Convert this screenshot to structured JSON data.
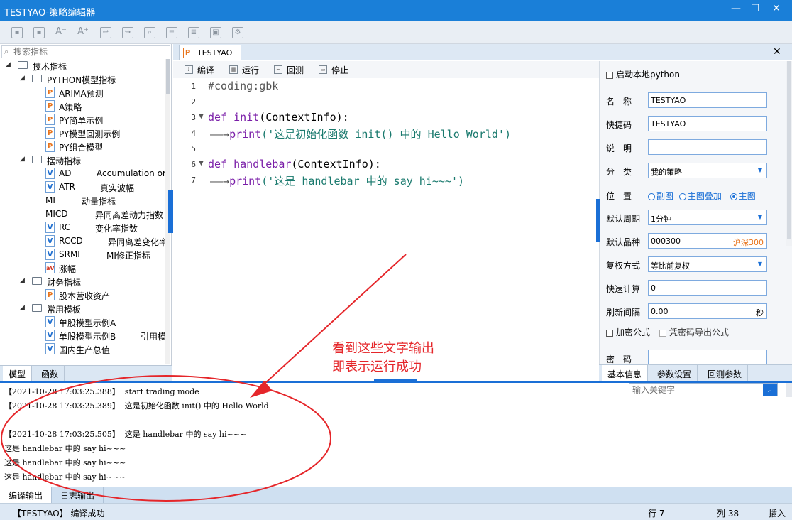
{
  "window": {
    "title": "TESTYAO-策略编辑器",
    "minimize_glyph": "—",
    "maximize_glyph": "☐",
    "close_glyph": "✕"
  },
  "toolbar": {
    "icons": [
      "save-icon",
      "save-as-icon",
      "font-decrease-icon",
      "font-increase-icon",
      "import-icon",
      "export-icon",
      "find-icon",
      "doc-icon",
      "doc-list-icon",
      "image-icon",
      "settings-icon"
    ]
  },
  "left": {
    "search_placeholder": "搜索指标",
    "tree": [
      {
        "level": 0,
        "type": "folder",
        "label": "技术指标"
      },
      {
        "level": 1,
        "type": "folder",
        "label": "PYTHON模型指标"
      },
      {
        "level": 2,
        "type": "p",
        "label": "ARIMA预测"
      },
      {
        "level": 2,
        "type": "p",
        "label": "A策略"
      },
      {
        "level": 2,
        "type": "p",
        "label": "PY简单示例"
      },
      {
        "level": 2,
        "type": "p",
        "label": "PY模型回测示例"
      },
      {
        "level": 2,
        "type": "p",
        "label": "PY组合模型"
      },
      {
        "level": 1,
        "type": "folder",
        "label": "摆动指标"
      },
      {
        "level": 2,
        "type": "v",
        "label": "AD",
        "desc": "Accumulation or"
      },
      {
        "level": 2,
        "type": "v",
        "label": "ATR",
        "desc": "真实波幅"
      },
      {
        "level": 2,
        "type": "none",
        "label": "MI",
        "desc": "动量指标"
      },
      {
        "level": 2,
        "type": "none",
        "label": "MICD",
        "desc": "异同离差动力指数"
      },
      {
        "level": 2,
        "type": "v",
        "label": "RC",
        "desc": "变化率指数"
      },
      {
        "level": 2,
        "type": "v",
        "label": "RCCD",
        "desc": "异同离差变化率"
      },
      {
        "level": 2,
        "type": "v",
        "label": "SRMI",
        "desc": "MI修正指标"
      },
      {
        "level": 2,
        "type": "av",
        "label": "涨幅"
      },
      {
        "level": 1,
        "type": "folder",
        "label": "财务指标"
      },
      {
        "level": 2,
        "type": "p",
        "label": "股本营收资产"
      },
      {
        "level": 1,
        "type": "folder",
        "label": "常用模板"
      },
      {
        "level": 2,
        "type": "v",
        "label": "单股模型示例A"
      },
      {
        "level": 2,
        "type": "v",
        "label": "单股模型示例B",
        "desc": "引用模"
      },
      {
        "level": 2,
        "type": "v",
        "label": "国内生产总值"
      }
    ],
    "tabs": [
      "模型",
      "函数"
    ]
  },
  "editor": {
    "tab_label": "TESTYAO",
    "tab_icon": "P",
    "toolbar": [
      {
        "icon": "compile-icon",
        "label": "编译"
      },
      {
        "icon": "run-icon",
        "label": "运行"
      },
      {
        "icon": "backtest-icon",
        "label": "回测"
      },
      {
        "icon": "stop-icon",
        "label": "停止"
      }
    ],
    "lines": [
      {
        "n": "1",
        "text": "#coding:gbk"
      },
      {
        "n": "2",
        "text": ""
      },
      {
        "n": "3",
        "text": "def init(ContextInfo):"
      },
      {
        "n": "4",
        "text": "    print('这是初始化函数 init() 中的 Hello World')"
      },
      {
        "n": "5",
        "text": ""
      },
      {
        "n": "6",
        "text": "def handlebar(ContextInfo):"
      },
      {
        "n": "7",
        "text": "    print('这是 handlebar 中的 say hi~~~')"
      }
    ],
    "tokens": {
      "l1": "#coding:gbk",
      "def": "def",
      "init_name": "init",
      "init_params": "(ContextInfo):",
      "print": "print",
      "l4_str": "('这是初始化函数 init() 中的 Hello World')",
      "hb_name": "handlebar",
      "hb_params": "(ContextInfo):",
      "l7_str": "('这是 handlebar 中的 say hi~~~')",
      "tab_arrow": "——→"
    }
  },
  "props": {
    "start_local_python": "启动本地python",
    "name_label": "名　称",
    "name_value": "TESTYAO",
    "shortcut_label": "快捷码",
    "shortcut_value": "TESTYAO",
    "desc_label": "说　明",
    "desc_value": "",
    "category_label": "分　类",
    "category_value": "我的策略",
    "position_label": "位　置",
    "position_options": [
      "副图",
      "主图叠加",
      "主图"
    ],
    "position_selected": "主图",
    "period_label": "默认周期",
    "period_value": "1分钟",
    "symbol_label": "默认品种",
    "symbol_value": "000300",
    "symbol_name": "沪深300",
    "adjust_label": "复权方式",
    "adjust_value": "等比前复权",
    "quick_calc_label": "快速计算",
    "quick_calc_value": "0",
    "refresh_label": "刷新间隔",
    "refresh_value": "0.00",
    "refresh_unit": "秒",
    "encrypt_label": "加密公式",
    "pwd_export_label": "凭密码导出公式",
    "password_label": "密　码",
    "tabs": [
      "基本信息",
      "参数设置",
      "回测参数"
    ]
  },
  "output": {
    "search_placeholder": "输入关键字",
    "lines": [
      "【2021-10-28 17:03:25.388】  start trading mode",
      "【2021-10-28 17:03:25.389】  这是初始化函数 init() 中的 Hello World",
      "",
      "【2021-10-28 17:03:25.505】  这是 handlebar 中的 say hi~~~",
      "这是 handlebar 中的 say hi~~~",
      "这是 handlebar 中的 say hi~~~",
      "这是 handlebar 中的 say hi~~~"
    ],
    "tabs": [
      "编译输出",
      "日志输出"
    ]
  },
  "status": {
    "message": "【TESTYAO】 编译成功",
    "row_label": "行 7",
    "col_label": "列 38",
    "mode": "插入"
  },
  "annotation": {
    "line1": "看到这些文字输出",
    "line2": "即表示运行成功",
    "color": "#e5262a"
  },
  "colors": {
    "accent": "#1a7fd8",
    "keyword": "#7a1ea8",
    "string": "#1a7a6e"
  }
}
